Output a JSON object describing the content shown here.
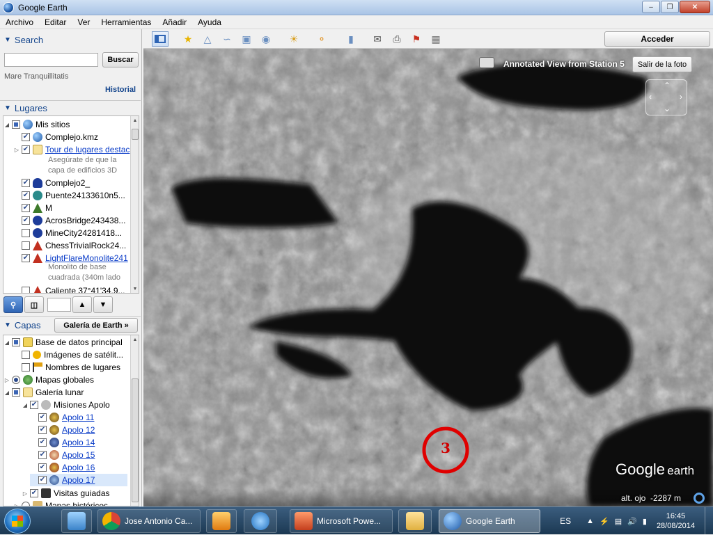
{
  "window": {
    "title": "Google Earth"
  },
  "menu": [
    "Archivo",
    "Editar",
    "Ver",
    "Herramientas",
    "Añadir",
    "Ayuda"
  ],
  "search": {
    "header": "Search",
    "button": "Buscar",
    "hint": "Mare Tranquillitatis",
    "history": "Historial"
  },
  "places": {
    "header": "Lugares",
    "root": "Mis sitios",
    "items": [
      {
        "label": "Complejo.kmz"
      },
      {
        "label": "Tour de lugares destac"
      },
      {
        "label": "Complejo2_"
      },
      {
        "label": "Puente24133610n5..."
      },
      {
        "label": "M"
      },
      {
        "label": "AcrosBridge243438..."
      },
      {
        "label": "MineCity24281418..."
      },
      {
        "label": "ChessTrivialRock24..."
      },
      {
        "label": "LightFlareMonolite241"
      },
      {
        "label": "Caliente 37°41'34.9..."
      }
    ],
    "tour_note": "Asegúrate de que la capa de edificios 3D",
    "monolith_note": "Monolito de base cuadrada (340m lado"
  },
  "layers": {
    "header": "Capas",
    "gallery_button": "Galería de Earth",
    "items": [
      {
        "label": "Base de datos principal"
      },
      {
        "label": "Imágenes de satélit..."
      },
      {
        "label": "Nombres de lugares"
      },
      {
        "label": "Mapas globales"
      },
      {
        "label": "Galería lunar"
      },
      {
        "label": "Misiones Apolo"
      },
      {
        "label": "Apolo 11"
      },
      {
        "label": "Apolo 12"
      },
      {
        "label": "Apolo 14"
      },
      {
        "label": "Apolo 15"
      },
      {
        "label": "Apolo 16"
      },
      {
        "label": "Apolo 17"
      },
      {
        "label": "Visitas guiadas"
      },
      {
        "label": "Mapas históricos"
      }
    ]
  },
  "toolbar": {
    "signin": "Acceder"
  },
  "map": {
    "photo_caption": "Annotated View from Station 5",
    "exit_photo": "Salir de la foto",
    "marker_number": "3",
    "logo_google": "Google",
    "logo_earth": "earth",
    "eye_alt_label": "alt. ojo",
    "eye_alt_value": "-2287 m"
  },
  "taskbar": {
    "tasks": [
      {
        "label": "Jose Antonio Ca..."
      },
      {
        "label": "Microsoft Powe..."
      },
      {
        "label": "Google Earth"
      }
    ],
    "lang": "ES",
    "time": "16:45",
    "date": "28/08/2014"
  }
}
